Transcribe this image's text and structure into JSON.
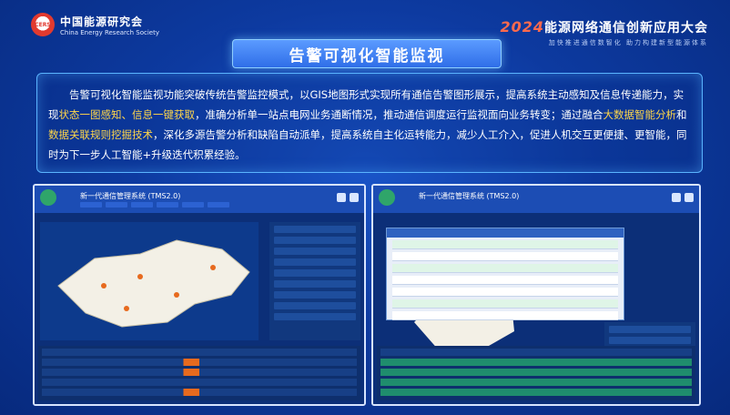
{
  "header": {
    "org_logo_text": "CERS",
    "org_name_cn": "中国能源研究会",
    "org_name_en": "China Energy Research Society",
    "conf_year": "2024",
    "conf_title": "能源网络通信创新应用大会",
    "conf_subtitle": "加快推进通信数智化 助力构建新型能源体系"
  },
  "title": "告警可视化智能监视",
  "description": {
    "p1": "告警可视化智能监视功能突破传统告警监控模式，以GIS地图形式实现所有通信告警图形展示，提高系统主动感知及信息传递能力，实现",
    "h1": "状态一图感知、信息一键获取",
    "p2": "，准确分析单一站点电网业务通断情况，推动通信调度运行监视面向业务转变；通过融合",
    "h2": "大数据智能分析",
    "p3": "和",
    "h3": "数据关联规则挖掘技术",
    "p4": "，深化多源告警分析和缺陷自动派单，提高系统自主化运转能力，减少人工介入，促进人机交互更便捷、更智能，同时为下一步人工智能+升级迭代积累经验。"
  },
  "screens": {
    "left_title": "新一代通信管理系统 (TMS2.0)",
    "right_title": "新一代通信管理系统 (TMS2.0)"
  },
  "colors": {
    "highlight": "#ffd64a",
    "alarm": "#e76a1e",
    "ok": "#1f8d6d"
  }
}
